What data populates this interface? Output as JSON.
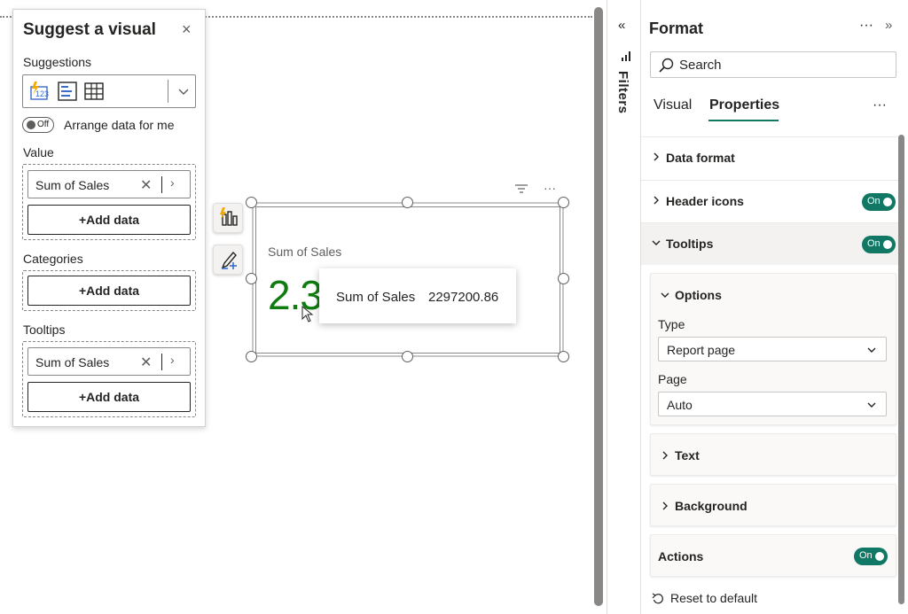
{
  "suggest_panel": {
    "title": "Suggest a visual",
    "close": "×",
    "suggestions_label": "Suggestions",
    "arrange_toggle": "Off",
    "arrange_label": "Arrange data for me",
    "value_label": "Value",
    "value_field": "Sum of Sales",
    "add_data": "+Add data",
    "categories_label": "Categories",
    "tooltips_label": "Tooltips",
    "tooltips_field": "Sum of Sales"
  },
  "visual": {
    "label": "Sum of Sales",
    "value": "2.3",
    "tooltip_key": "Sum of Sales",
    "tooltip_value": "2297200.86",
    "value_color": "#107c10"
  },
  "filters": {
    "label": "Filters",
    "collapse": "«"
  },
  "format_pane": {
    "title": "Format",
    "more": "···",
    "expand": "»",
    "search_placeholder": "Search",
    "tabs": [
      {
        "label": "Visual"
      },
      {
        "label": "Properties"
      }
    ],
    "tabs_more": "···",
    "sections": {
      "data_format": "Data format",
      "header_icons": "Header icons",
      "tooltips": "Tooltips",
      "options": "Options",
      "type_label": "Type",
      "type_value": "Report page",
      "page_label": "Page",
      "page_value": "Auto",
      "text": "Text",
      "background": "Background",
      "actions": "Actions"
    },
    "toggle_on": "On",
    "reset": "Reset to default",
    "accent": "#117865"
  }
}
